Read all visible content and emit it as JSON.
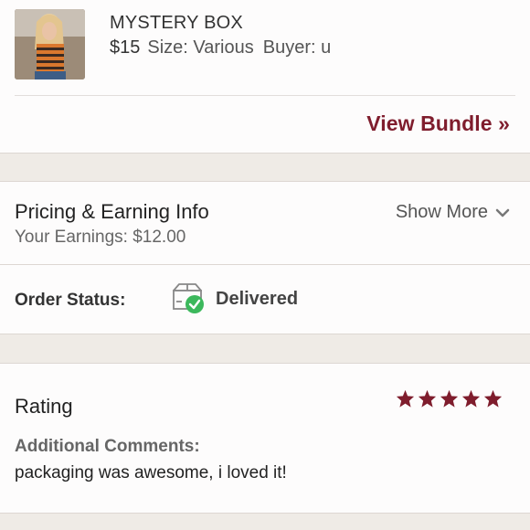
{
  "item": {
    "title": "MYSTERY BOX",
    "price": "$15",
    "size": "Size: Various",
    "buyer": "Buyer: u",
    "image_icon": "product-photo"
  },
  "bundle": {
    "view_label": "View Bundle »"
  },
  "pricing": {
    "title": "Pricing & Earning Info",
    "earnings": "Your Earnings: $12.00",
    "show_more": "Show More",
    "show_more_icon": "chevron-down-icon"
  },
  "order_status": {
    "label": "Order Status:",
    "value": "Delivered",
    "icon": "delivered-box-icon",
    "icon_color": "#3cb85c"
  },
  "rating": {
    "title": "Rating",
    "stars": 5,
    "star_color": "#7f1d2d",
    "comments_label": "Additional Comments:",
    "comments_text": "packaging was awesome, i loved it!"
  },
  "colors": {
    "accent": "#7f1d2d",
    "background": "#efebe6",
    "card": "#fdfcfc"
  }
}
